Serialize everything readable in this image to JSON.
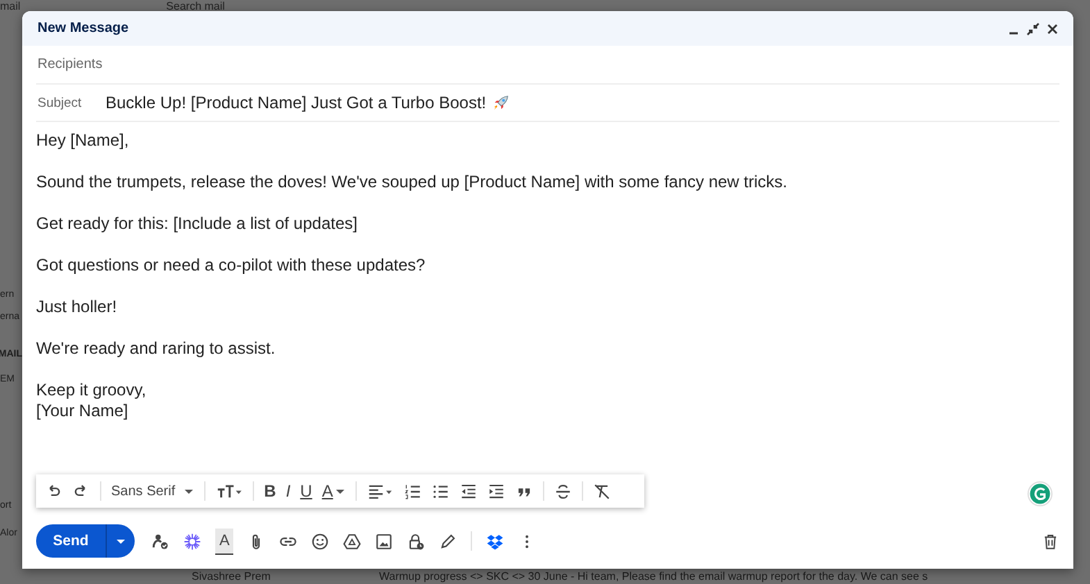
{
  "background": {
    "logo": "mail",
    "search_placeholder": "Search mail",
    "sidebar_fragments": [
      "ern",
      "erna",
      "MAIL",
      "EM",
      "ort",
      "Alor"
    ],
    "email_row": {
      "sender": "Sivashree Prem",
      "preview": "Warmup progress <> SKC <> 30 June - Hi team, Please find the email warmup report for the day. We can see s"
    }
  },
  "compose": {
    "title": "New Message",
    "recipients_placeholder": "Recipients",
    "subject_label": "Subject",
    "subject": "Buckle Up! [Product Name] Just Got a Turbo Boost!",
    "body": [
      [
        "Hey [Name],"
      ],
      [
        "Sound the trumpets, release the doves! We've souped up [Product Name] with some fancy new tricks."
      ],
      [
        "Get ready for this: [Include a list of updates]"
      ],
      [
        "Got questions or need a co-pilot with these updates?"
      ],
      [
        "Just holler!"
      ],
      [
        "We're ready and raring to assist."
      ],
      [
        "Keep it groovy,",
        "[Your Name]"
      ]
    ],
    "toolbar": {
      "font": "Sans Serif",
      "glyphs": [
        "B",
        "I",
        "U",
        "A"
      ]
    },
    "send_label": "Send",
    "format_toggle": {
      "label": "A",
      "selected": true
    }
  }
}
